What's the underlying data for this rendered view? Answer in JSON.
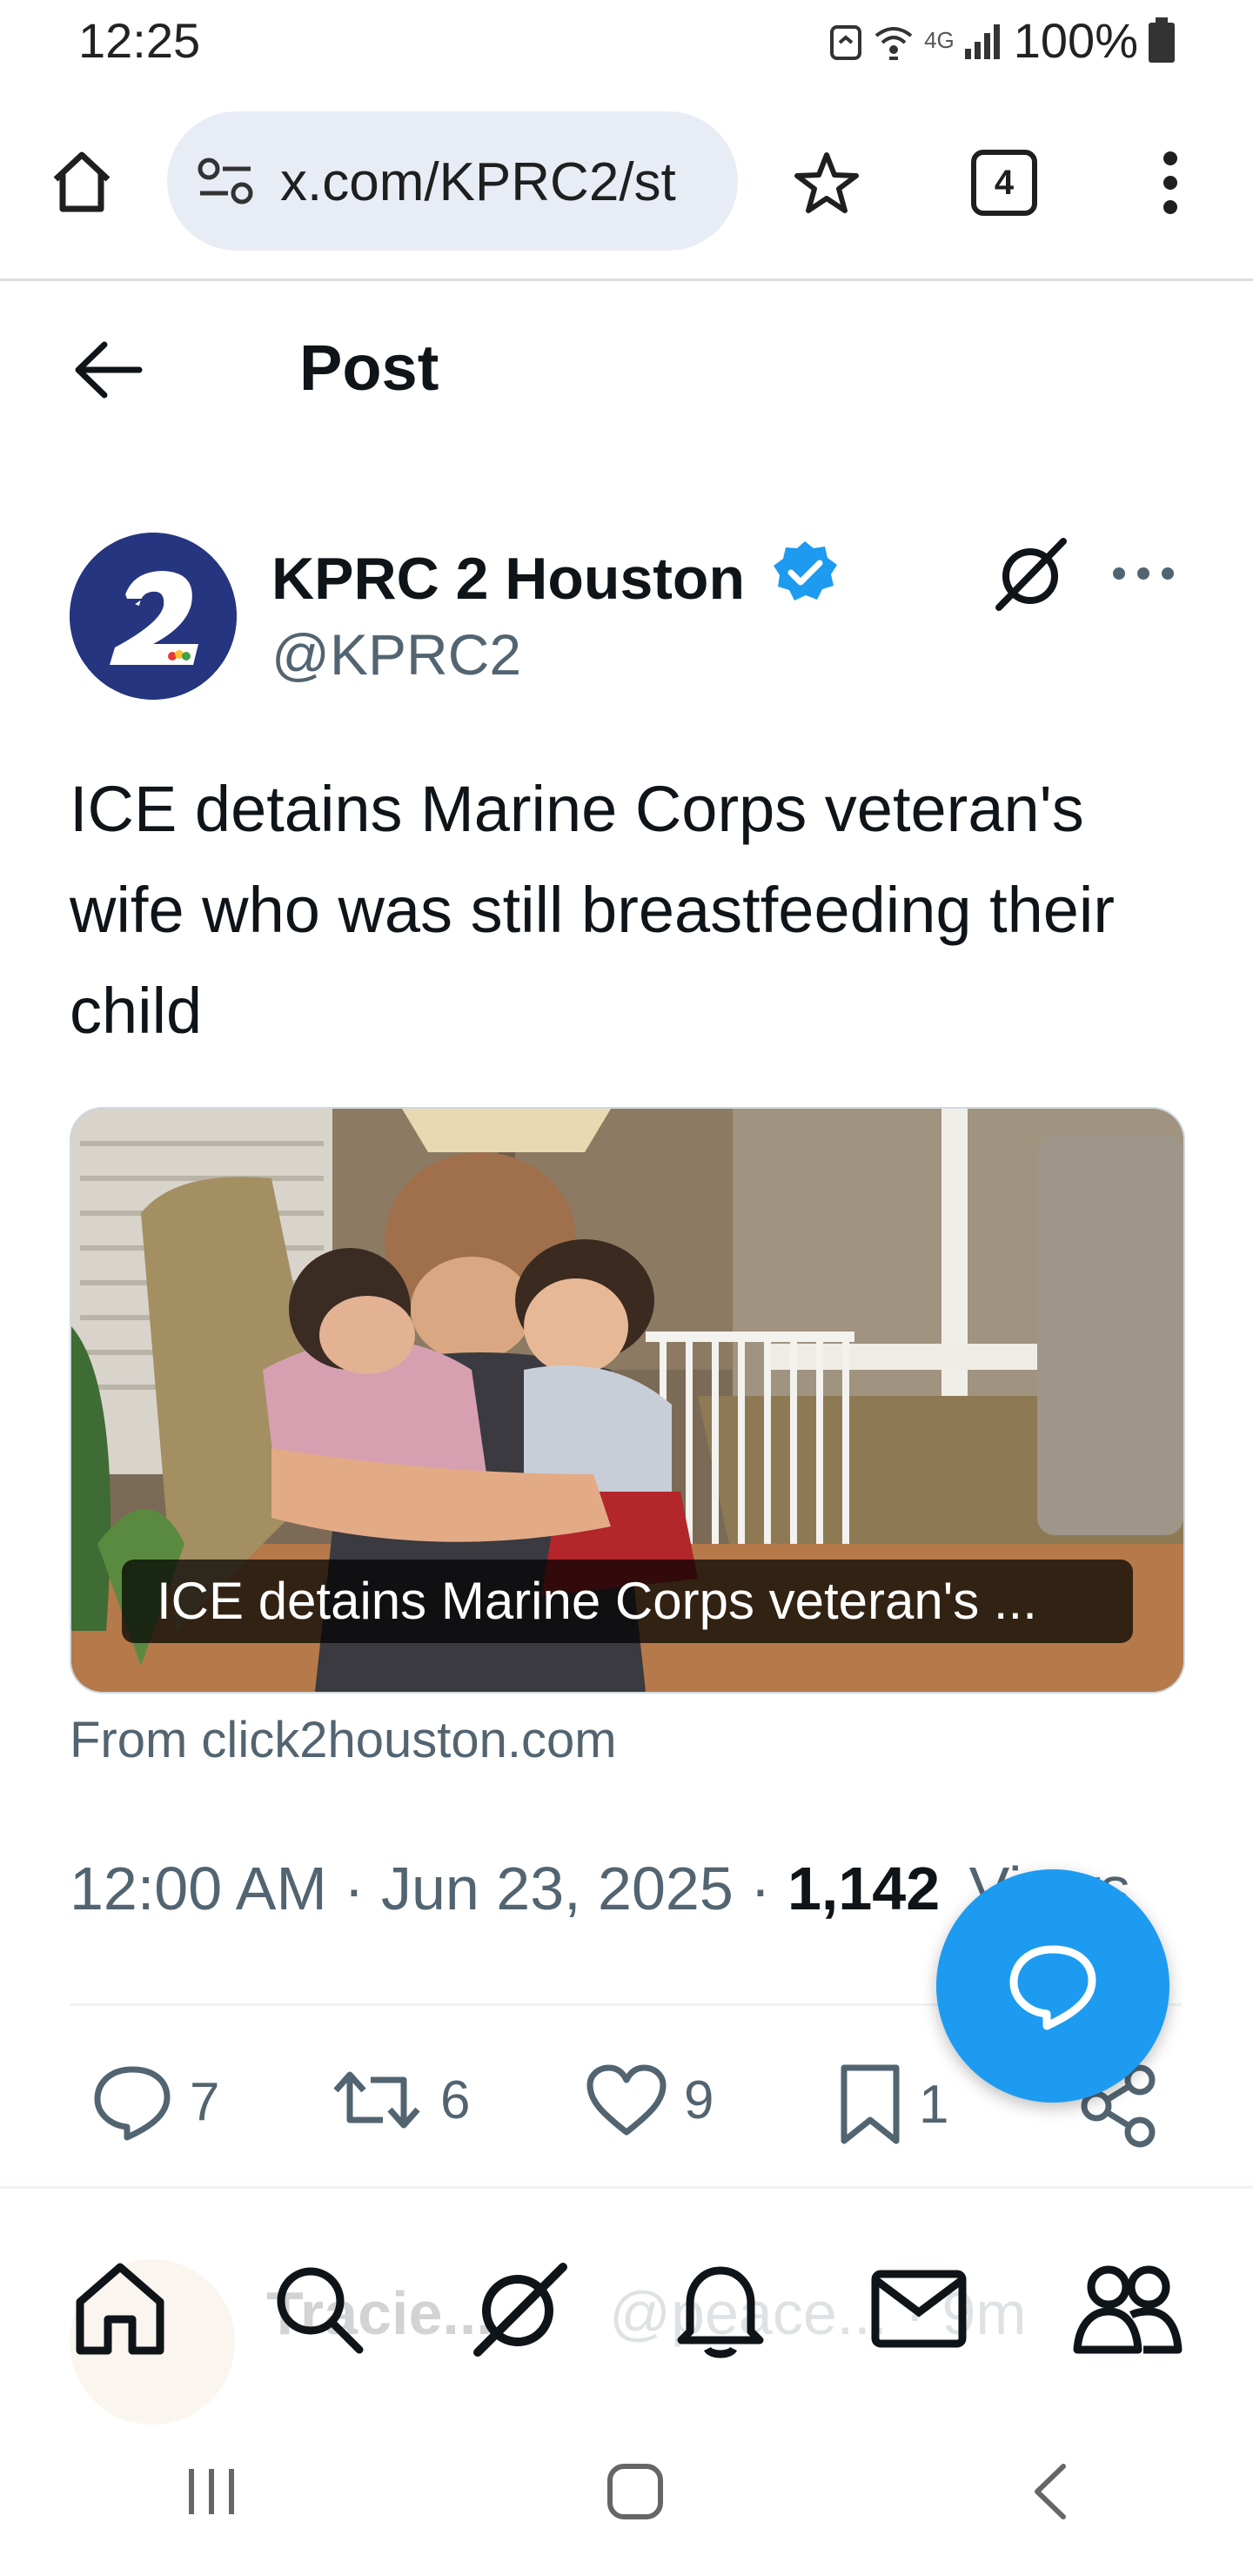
{
  "status_bar": {
    "time": "12:25",
    "network": "4G",
    "battery": "100%"
  },
  "browser": {
    "url": "x.com/KPRC2/st",
    "tab_count": "4"
  },
  "header": {
    "title": "Post"
  },
  "post": {
    "author_name": "KPRC 2 Houston",
    "author_handle": "@KPRC2",
    "text": "ICE detains Marine Corps veteran's wife who was still breastfeeding their child",
    "card_caption": "ICE detains Marine Corps veteran's ...",
    "card_source": "From click2houston.com",
    "time": "12:00 AM",
    "date": "Jun 23, 2025",
    "views_count": "1,142",
    "views_label": "Views",
    "replies": "7",
    "reposts": "6",
    "likes": "9",
    "bookmarks": "1"
  },
  "reply_preview": {
    "name": "Tracie...",
    "handle": "@peace...",
    "age": "9m"
  },
  "colors": {
    "accent": "#1d9bf0",
    "text_primary": "#0f1419",
    "text_secondary": "#536471",
    "verified": "#1d9bf0"
  },
  "icons": {
    "home": "home-icon",
    "search": "search-icon",
    "grok": "grok-icon",
    "notifications": "bell-icon",
    "messages": "mail-icon",
    "communities": "people-icon"
  }
}
